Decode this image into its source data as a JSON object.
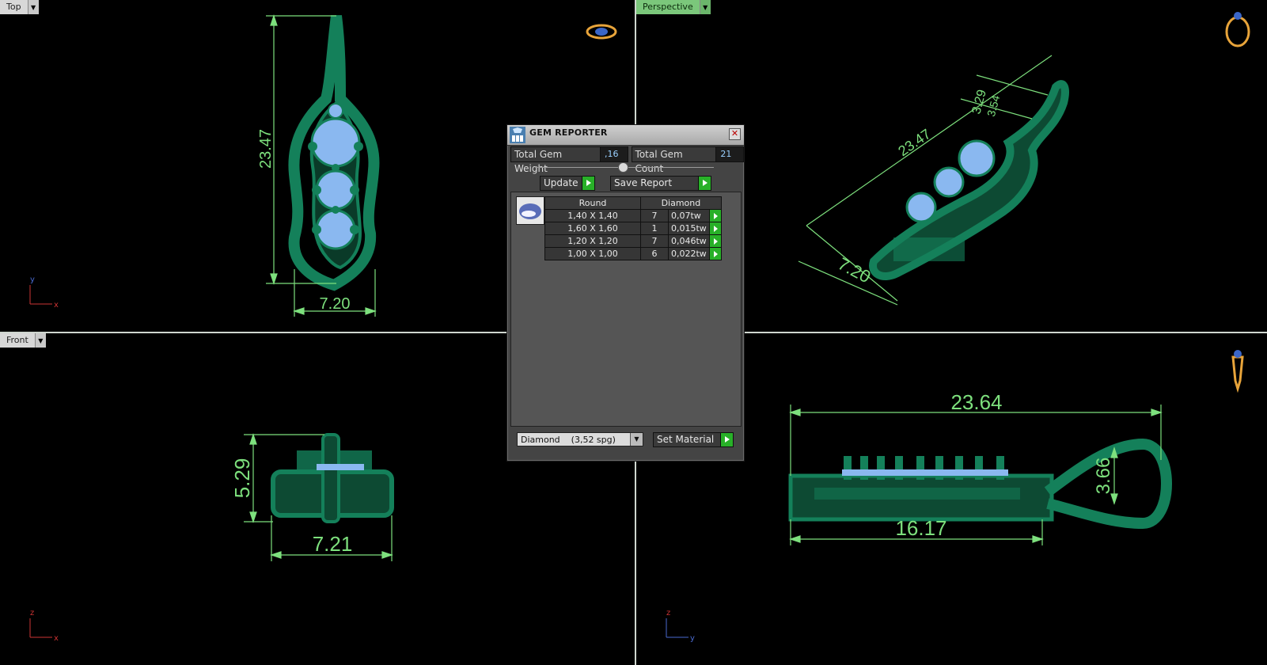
{
  "viewports": {
    "top": {
      "label": "Top",
      "dims": {
        "height": "23.47",
        "width": "7.20"
      },
      "axes": {
        "v": "y",
        "h": "x"
      }
    },
    "perspective": {
      "label": "Perspective",
      "dims": {
        "length": "23.47",
        "width": "7.20",
        "a": "3.29",
        "b": "3.54"
      }
    },
    "front": {
      "label": "Front",
      "dims": {
        "height": "5.29",
        "width": "7.21"
      },
      "axes": {
        "v": "z",
        "h": "x"
      }
    },
    "side": {
      "dims": {
        "length": "23.64",
        "inner": "16.17",
        "loop": "3.66"
      },
      "axes": {
        "v": "z",
        "h": "y"
      }
    }
  },
  "gem_reporter": {
    "title": "GEM REPORTER",
    "total_weight_label": "Total Gem Weight",
    "total_weight_value": ",16",
    "total_count_label": "Total Gem Count",
    "total_count_value": "21",
    "update_label": "Update",
    "save_label": "Save Report",
    "table": {
      "headers": [
        "Round",
        "",
        "Diamond"
      ],
      "rows": [
        {
          "size": "1,40 X 1,40",
          "count": "7",
          "weight": "0,07tw"
        },
        {
          "size": "1,60 X 1,60",
          "count": "1",
          "weight": "0,015tw"
        },
        {
          "size": "1,20 X 1,20",
          "count": "7",
          "weight": "0,046tw"
        },
        {
          "size": "1,00 X 1,00",
          "count": "6",
          "weight": "0,022tw"
        }
      ]
    },
    "material_value": "Diamond    (3,52 spg)",
    "set_material_label": "Set Material"
  },
  "colors": {
    "model": "#14805a",
    "dimension": "#7de07d",
    "gem": "#8ab8f0"
  }
}
